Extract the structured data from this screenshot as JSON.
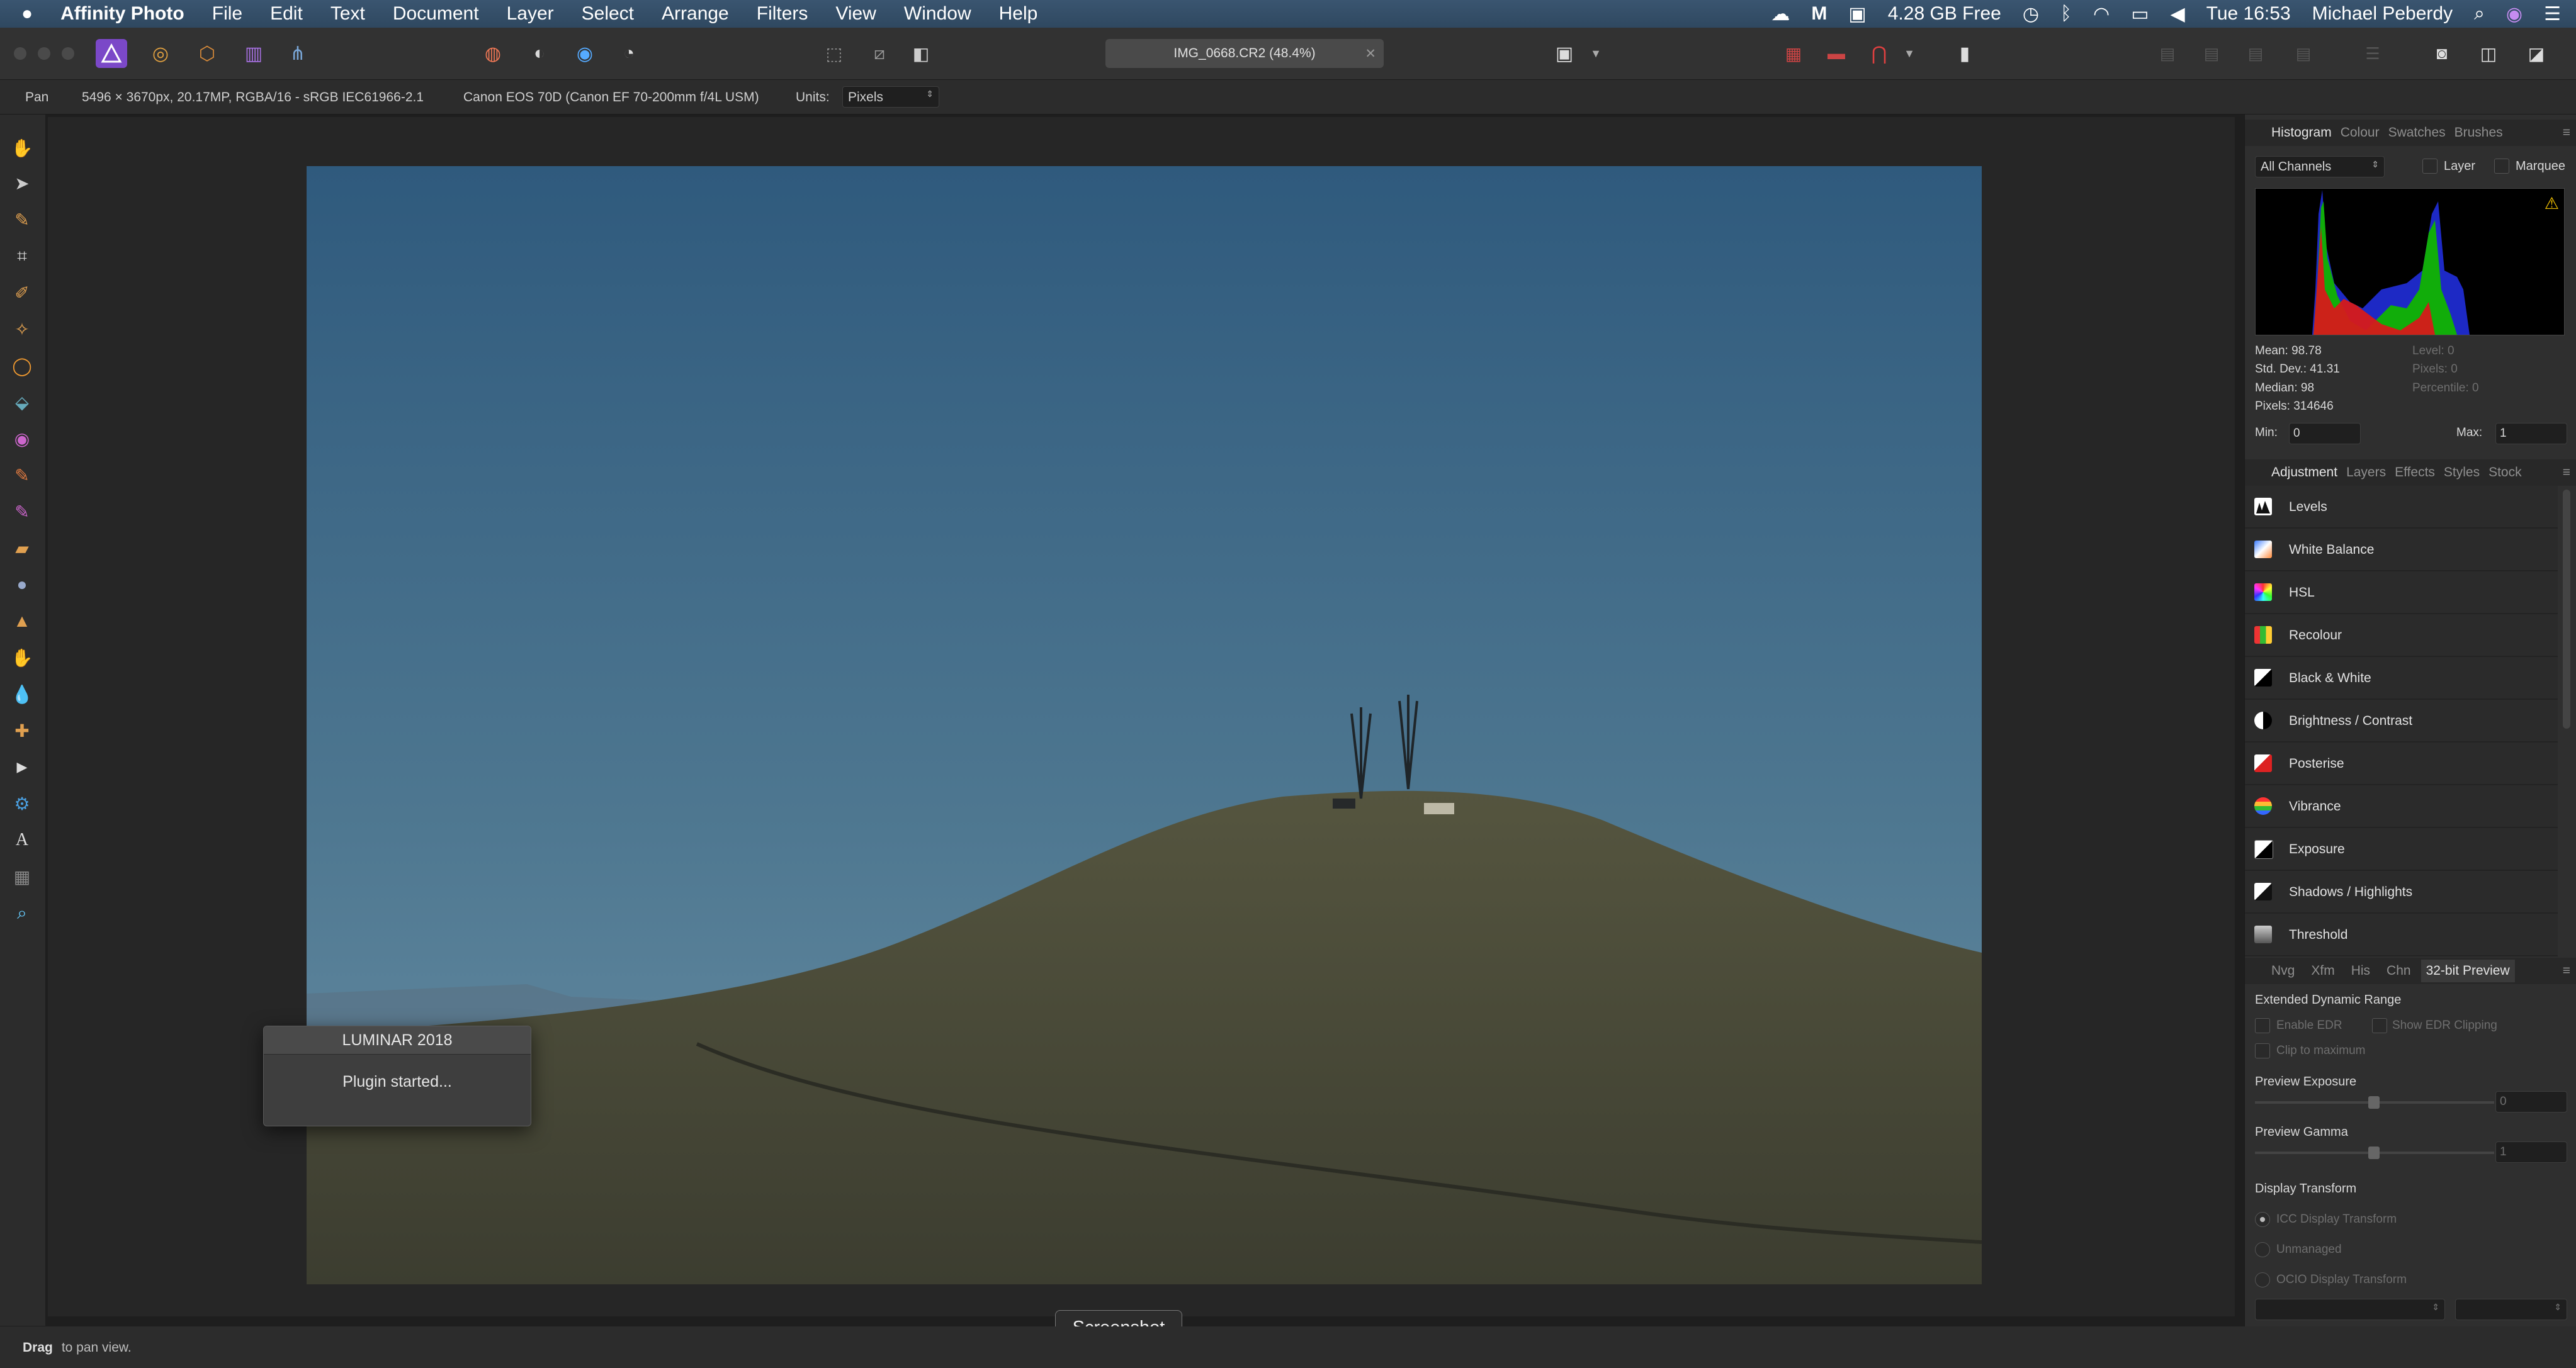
{
  "menubar": {
    "app_name": "Affinity Photo",
    "menus": [
      "File",
      "Edit",
      "Text",
      "Document",
      "Layer",
      "Select",
      "Arrange",
      "Filters",
      "View",
      "Window",
      "Help"
    ],
    "memory": "4.28 GB Free",
    "clock": "Tue 16:53",
    "user": "Michael Peberdy"
  },
  "toolbar": {
    "document_tab": "IMG_0668.CR2 (48.4%)"
  },
  "context": {
    "tool_name": "Pan",
    "image_info": "5496 × 3670px, 20.17MP, RGBA/16 - sRGB IEC61966-2.1",
    "camera": "Canon EOS 70D (Canon EF 70-200mm f/4L USM)",
    "units_label": "Units:",
    "units_value": "Pixels"
  },
  "histogram": {
    "tabs": [
      "Histogram",
      "Colour",
      "Swatches",
      "Brushes"
    ],
    "channel": "All Channels",
    "layer_label": "Layer",
    "marquee_label": "Marquee",
    "mean": "Mean: 98.78",
    "std_dev": "Std. Dev.: 41.31",
    "median": "Median: 98",
    "pixels": "Pixels: 314646",
    "level": "Level: 0",
    "pixels_right": "Pixels: 0",
    "percentile": "Percentile: 0",
    "min_label": "Min:",
    "min_value": "0",
    "max_label": "Max:",
    "max_value": "1"
  },
  "adjustment": {
    "tabs": [
      "Adjustment",
      "Layers",
      "Effects",
      "Styles",
      "Stock"
    ],
    "items": [
      "Levels",
      "White Balance",
      "HSL",
      "Recolour",
      "Black & White",
      "Brightness / Contrast",
      "Posterise",
      "Vibrance",
      "Exposure",
      "Shadows / Highlights",
      "Threshold"
    ]
  },
  "preview": {
    "tabs": [
      "Nvg",
      "Xfm",
      "His",
      "Chn",
      "32-bit Preview"
    ],
    "edr_title": "Extended Dynamic Range",
    "enable_edr": "Enable EDR",
    "show_edr_clipping": "Show EDR Clipping",
    "clip_to_max": "Clip to maximum",
    "exposure_label": "Preview Exposure",
    "exposure_value": "0",
    "gamma_label": "Preview Gamma",
    "gamma_value": "1",
    "display_transform": "Display Transform",
    "icc": "ICC Display Transform",
    "unmanaged": "Unmanaged",
    "ocio": "OCIO Display Transform"
  },
  "dialog": {
    "title": "LUMINAR 2018",
    "message": "Plugin started..."
  },
  "tooltip": "Screenshot",
  "status": {
    "bold": "Drag",
    "rest": " to pan view."
  },
  "colors": {
    "accent": "#7b48c8",
    "sky_top": "#2f5a7d",
    "sky_bottom": "#6a90a6",
    "hill": "#4b4c3a"
  },
  "icons": [
    "apple-icon",
    "hand-icon",
    "move-icon",
    "crop-icon",
    "paintbrush-icon",
    "text-icon",
    "zoom-icon",
    "search-icon",
    "wifi-icon"
  ]
}
